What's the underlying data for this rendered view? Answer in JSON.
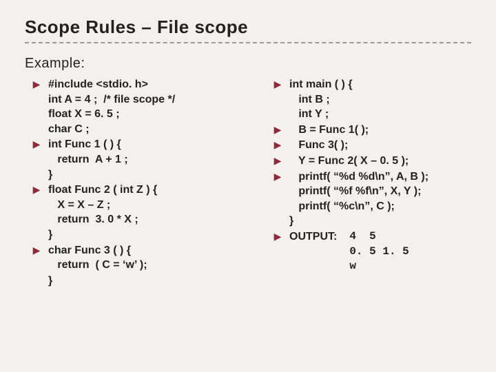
{
  "title": "Scope Rules – File scope",
  "subtitle": "Example:",
  "left": [
    {
      "bullet": true,
      "text": "#include <stdio. h>\nint A = 4 ;  /* file scope */\nfloat X = 6. 5 ;\nchar C ;"
    },
    {
      "bullet": true,
      "text": "int Func 1 ( ) {\n   return  A + 1 ;\n}"
    },
    {
      "bullet": true,
      "text": "float Func 2 ( int Z ) {\n   X = X – Z ;\n   return  3. 0 * X ;\n}"
    },
    {
      "bullet": true,
      "text": "char Func 3 ( ) {\n   return  ( C = ‘w’ );"
    },
    {
      "bullet": false,
      "text": "}"
    }
  ],
  "right": [
    {
      "bullet": true,
      "text": "int main ( ) {\n   int B ;\n   int Y ;"
    },
    {
      "bullet": true,
      "text": "   B = Func 1( );"
    },
    {
      "bullet": true,
      "text": "   Func 3( );"
    },
    {
      "bullet": true,
      "text": "   Y = Func 2( X – 0. 5 );"
    },
    {
      "bullet": true,
      "text": "   printf( “%d %d\\n”, A, B );\n   printf( “%f %f\\n”, X, Y );\n   printf( “%c\\n”, C );\n}"
    }
  ],
  "output": {
    "label": "OUTPUT:",
    "lines": "4  5\n0. 5 1. 5\nw"
  }
}
